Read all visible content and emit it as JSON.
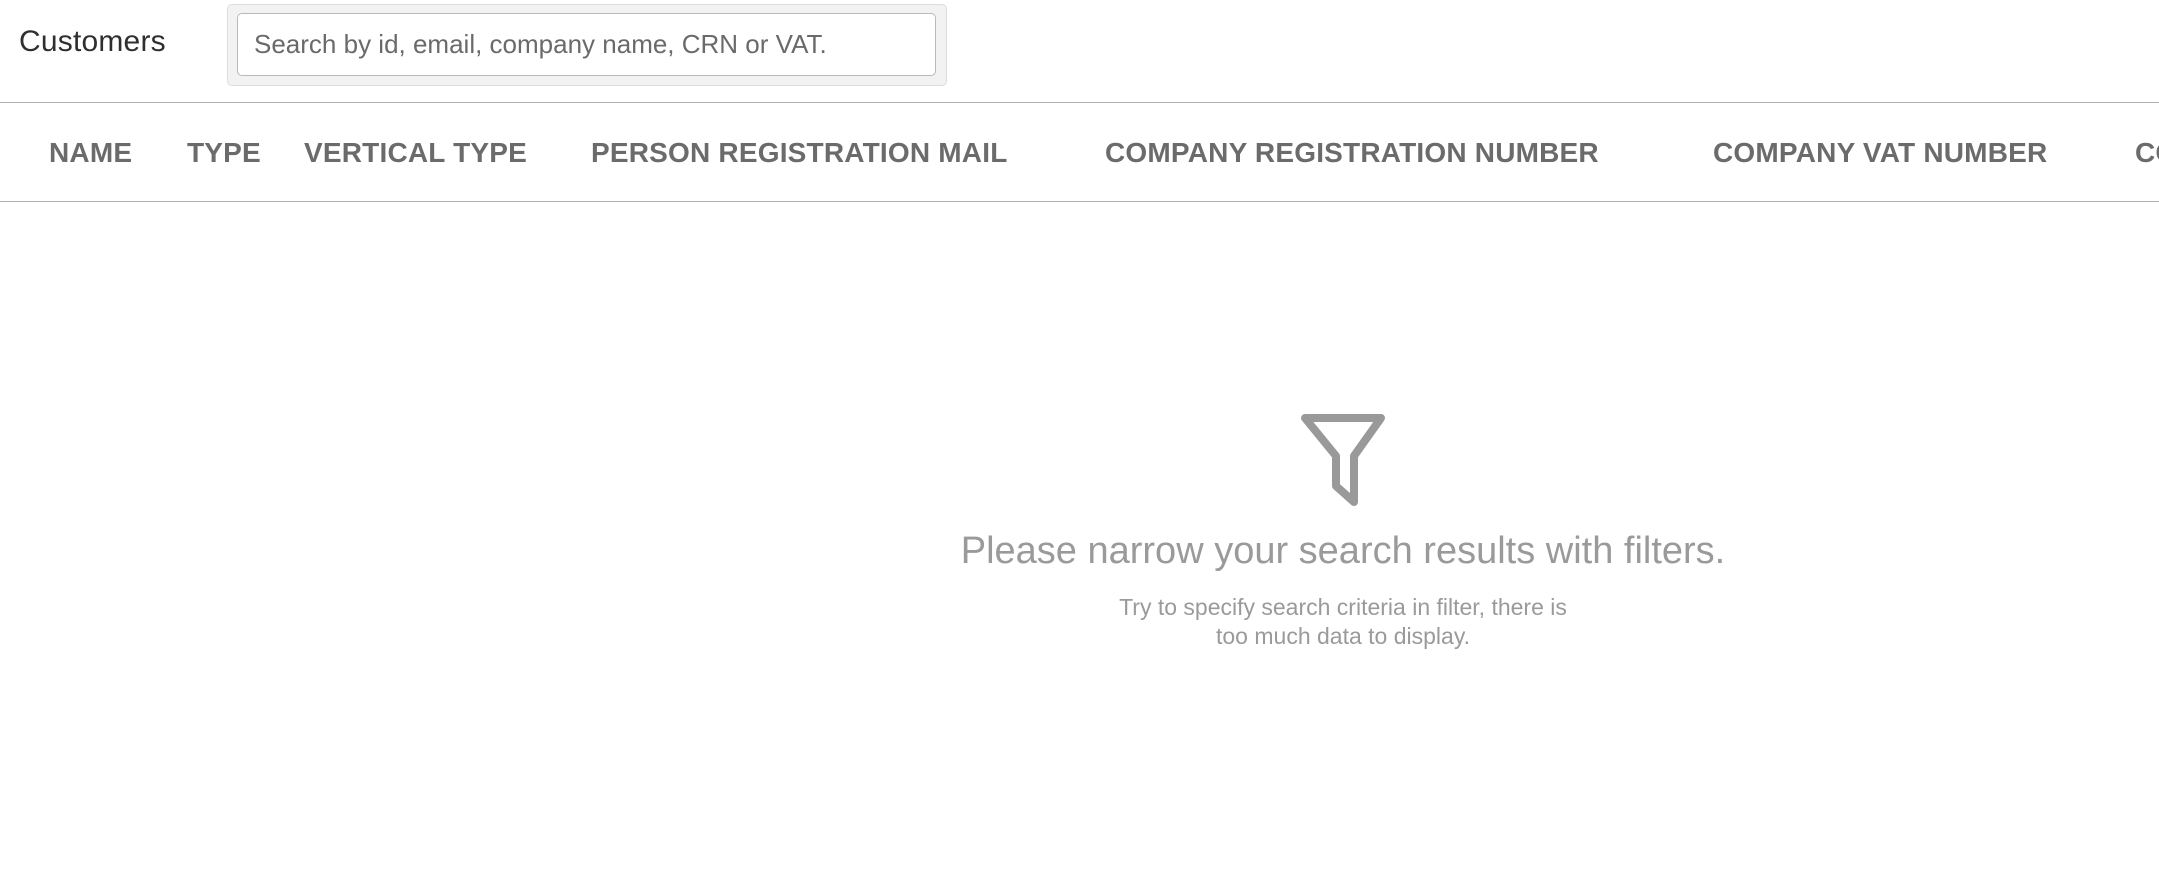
{
  "header": {
    "title": "Customers",
    "search": {
      "placeholder": "Search by id, email, company name, CRN or VAT.",
      "value": ""
    }
  },
  "table": {
    "columns": [
      "NAME",
      "TYPE",
      "VERTICAL TYPE",
      "PERSON REGISTRATION MAIL",
      "COMPANY REGISTRATION NUMBER",
      "COMPANY VAT NUMBER",
      "CO"
    ]
  },
  "empty_state": {
    "icon": "filter-icon",
    "title": "Please narrow your search results with filters.",
    "subtitle_line1": "Try to specify search criteria in filter, there is",
    "subtitle_line2": "too much data to display."
  }
}
